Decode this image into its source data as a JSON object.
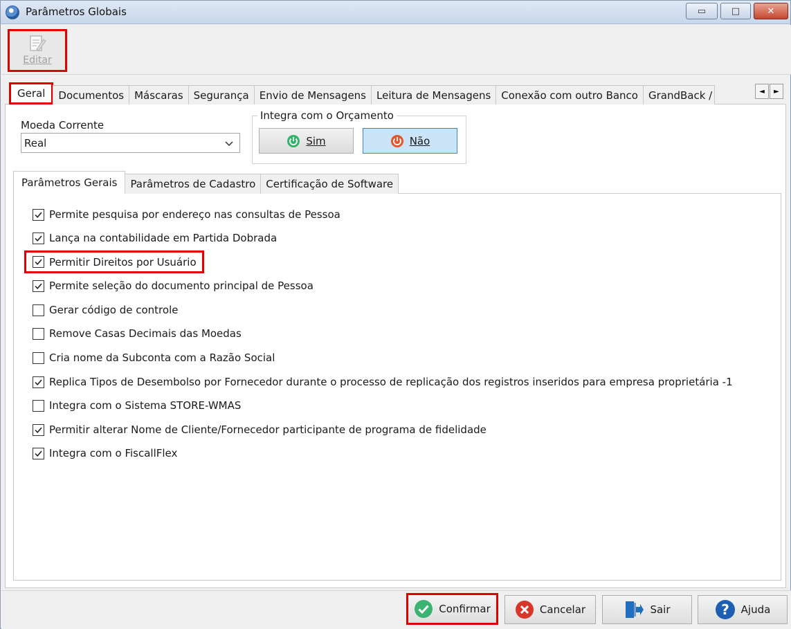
{
  "window": {
    "title": "Parâmetros Globais",
    "minimize": "▭",
    "maximize": "□",
    "close": "✕"
  },
  "toolbar": {
    "edit_label": "Editar"
  },
  "main_tabs": [
    {
      "label": "Geral"
    },
    {
      "label": "Documentos"
    },
    {
      "label": "Máscaras"
    },
    {
      "label": "Segurança"
    },
    {
      "label": "Envio de Mensagens"
    },
    {
      "label": "Leitura de Mensagens"
    },
    {
      "label": "Conexão com outro Banco"
    },
    {
      "label": "GrandBack / I"
    }
  ],
  "tab_scroll": {
    "left": "◄",
    "right": "►"
  },
  "geral": {
    "moeda_label": "Moeda Corrente",
    "moeda_value": "Real",
    "orcamento_legend": "Integra com o Orçamento",
    "sim_label": "Sim",
    "nao_label": "Não"
  },
  "sub_tabs": [
    {
      "label": "Parâmetros Gerais"
    },
    {
      "label": "Parâmetros de Cadastro"
    },
    {
      "label": "Certificação de Software"
    }
  ],
  "checkboxes": [
    {
      "label": "Permite pesquisa por endereço nas consultas de Pessoa",
      "checked": true
    },
    {
      "label": "Lança na contabilidade em Partida Dobrada",
      "checked": true
    },
    {
      "label": "Permitir Direitos por Usuário",
      "checked": true
    },
    {
      "label": "Permite seleção do documento principal de Pessoa",
      "checked": true
    },
    {
      "label": "Gerar código de controle",
      "checked": false
    },
    {
      "label": "Remove Casas Decimais das Moedas",
      "checked": false
    },
    {
      "label": "Cria nome da Subconta com a Razão Social",
      "checked": false
    },
    {
      "label": "Replica Tipos de Desembolso por Fornecedor durante o processo de replicação dos registros inseridos para empresa proprietária -1",
      "checked": true
    },
    {
      "label": "Integra com o Sistema STORE-WMAS",
      "checked": false
    },
    {
      "label": "Permitir alterar Nome de Cliente/Fornecedor participante de programa de fidelidade",
      "checked": true
    },
    {
      "label": "Integra com o FiscallFlex",
      "checked": true
    }
  ],
  "bottom": {
    "confirm": "Confirmar",
    "cancel": "Cancelar",
    "exit": "Sair",
    "help": "Ajuda"
  },
  "colors": {
    "highlight": "#e00000",
    "confirm_green": "#3cb371",
    "cancel_red": "#d9362b",
    "exit_blue": "#1f6fbf",
    "help_blue": "#1e5fb3"
  }
}
